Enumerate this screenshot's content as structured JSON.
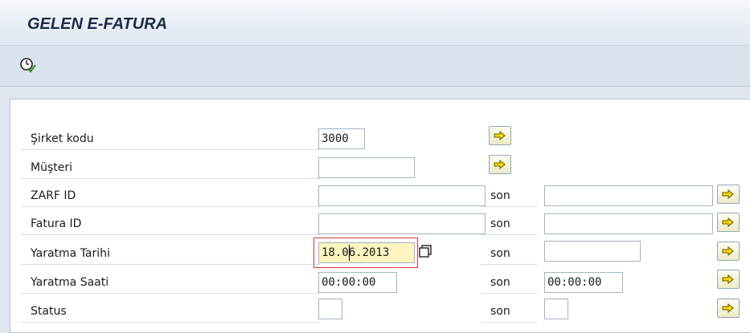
{
  "header": {
    "title": "GELEN E-FATURA"
  },
  "toolbar": {
    "execute_icon": "execute-clock-check-icon"
  },
  "form": {
    "range_to_label": "son",
    "fields": [
      {
        "label": "Şirket kodu",
        "low": "3000",
        "high": null
      },
      {
        "label": "Müşteri",
        "low": "",
        "high": null
      },
      {
        "label": "ZARF ID",
        "low": "",
        "high": ""
      },
      {
        "label": "Fatura ID",
        "low": "",
        "high": ""
      },
      {
        "label": "Yaratma Tarihi",
        "low": "18.06.2013",
        "high": ""
      },
      {
        "label": "Yaratma Saati",
        "low": "00:00:00",
        "high": "00:00:00"
      },
      {
        "label": "Status",
        "low": "",
        "high": ""
      }
    ]
  },
  "colors": {
    "focus_field": "#fdf4c0",
    "focus_border": "#d23a3a",
    "arrow_fill": "#f5d800"
  }
}
